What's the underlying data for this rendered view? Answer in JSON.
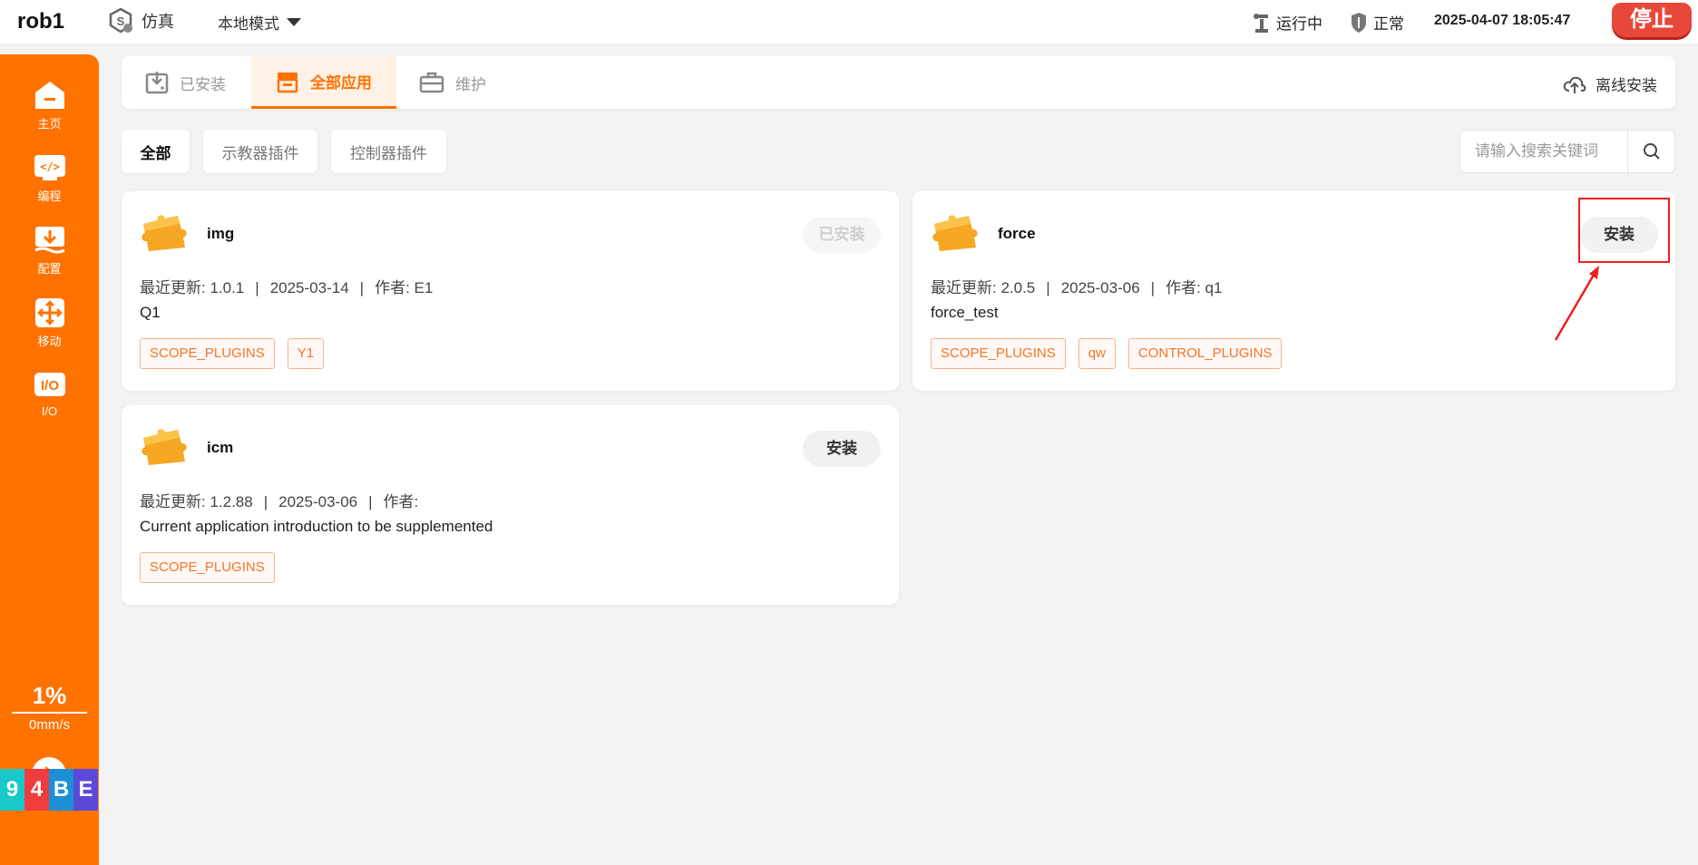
{
  "header": {
    "app_title": "rob1",
    "sim_label": "仿真",
    "mode_label": "本地模式",
    "status_running": "运行中",
    "status_normal": "正常",
    "datetime": "2025-04-07 18:05:47",
    "stop_label": "停止"
  },
  "sidebar": {
    "items": [
      {
        "label": "主页",
        "icon": "home-icon"
      },
      {
        "label": "编程",
        "icon": "code-icon"
      },
      {
        "label": "配置",
        "icon": "config-icon"
      },
      {
        "label": "移动",
        "icon": "move-icon"
      },
      {
        "label": "I/O",
        "icon": "io-icon"
      }
    ],
    "speed_percent": "1%",
    "speed_value": "0mm/s",
    "badges": [
      {
        "text": "9",
        "color": "#19c9c9"
      },
      {
        "text": "4",
        "color": "#f03c3c"
      },
      {
        "text": "B",
        "color": "#1e8fd6"
      },
      {
        "text": "E",
        "color": "#5b4ad8"
      }
    ]
  },
  "tabs": [
    {
      "label": "已安装",
      "active": false
    },
    {
      "label": "全部应用",
      "active": true
    },
    {
      "label": "维护",
      "active": false
    }
  ],
  "offline_install_label": "离线安装",
  "filters": [
    {
      "label": "全部",
      "active": true
    },
    {
      "label": "示教器插件",
      "active": false
    },
    {
      "label": "控制器插件",
      "active": false
    }
  ],
  "search": {
    "placeholder": "请输入搜索关键词",
    "value": ""
  },
  "cards": [
    {
      "name": "img",
      "action": "已安装",
      "action_disabled": true,
      "update_label": "最近更新: 1.0.1",
      "date": "2025-03-14",
      "author_label": "作者: E1",
      "description": "Q1",
      "tags": [
        "SCOPE_PLUGINS",
        "Y1"
      ]
    },
    {
      "name": "force",
      "action": "安装",
      "action_disabled": false,
      "update_label": "最近更新: 2.0.5",
      "date": "2025-03-06",
      "author_label": "作者: q1",
      "description": "force_test",
      "tags": [
        "SCOPE_PLUGINS",
        "qw",
        "CONTROL_PLUGINS"
      ]
    },
    {
      "name": "icm",
      "action": "安装",
      "action_disabled": false,
      "update_label": "最近更新: 1.2.88",
      "date": "2025-03-06",
      "author_label": "作者:",
      "description": "Current application introduction to be supplemented",
      "tags": [
        "SCOPE_PLUGINS"
      ]
    }
  ],
  "separator": "|",
  "colors": {
    "accent": "#ff7200",
    "annotation": "#f01e1e"
  }
}
